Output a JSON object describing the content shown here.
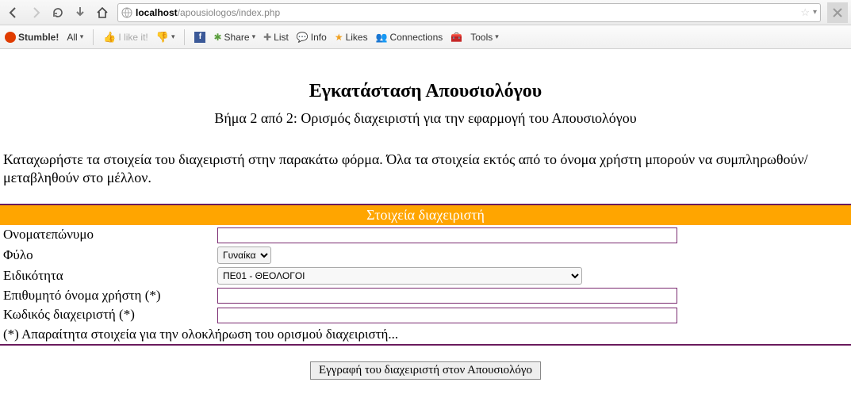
{
  "browser": {
    "url_host": "localhost",
    "url_path": "/apousiologos/index.php"
  },
  "bookmarks": {
    "stumble": "Stumble!",
    "all": "All",
    "like": "I like it!",
    "share": "Share",
    "list": "List",
    "info": "Info",
    "likes": "Likes",
    "connections": "Connections",
    "tools": "Tools"
  },
  "page": {
    "title": "Εγκατάσταση Απουσιολόγου",
    "subtitle": "Βήμα 2 από 2: Ορισμός διαχειριστή για την εφαρμογή του Απουσιολόγου",
    "instructions": "Καταχωρήστε τα στοιχεία του διαχειριστή στην παρακάτω φόρμα. Όλα τα στοιχεία εκτός από το όνομα χρήστη μπορούν να συμπληρωθούν/μεταβληθούν στο μέλλον.",
    "section_header": "Στοιχεία διαχειριστή",
    "note": "(*) Απαραίτητα στοιχεία για την ολοκλήρωση του ορισμού διαχειριστή...",
    "submit": "Εγγραφή του διαχειριστή στον Απουσιολόγο"
  },
  "form": {
    "fullname_label": "Ονοματεπώνυμο",
    "fullname_value": "",
    "gender_label": "Φύλο",
    "gender_value": "Γυναίκα",
    "specialty_label": "Ειδικότητα",
    "specialty_value": "ΠΕ01 - ΘΕΟΛΟΓΟΙ",
    "username_label": "Επιθυμητό όνομα χρήστη (*)",
    "username_value": "",
    "password_label": "Κωδικός διαχειριστή (*)",
    "password_value": ""
  }
}
